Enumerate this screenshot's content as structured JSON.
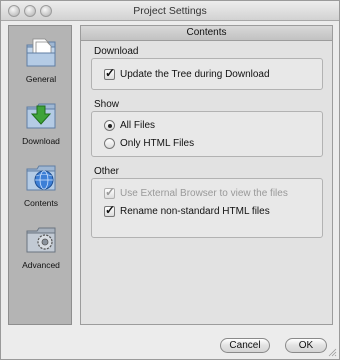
{
  "window": {
    "title": "Project Settings"
  },
  "sidebar": {
    "items": [
      {
        "label": "General",
        "icon": "general-icon"
      },
      {
        "label": "Download",
        "icon": "download-icon"
      },
      {
        "label": "Contents",
        "icon": "contents-icon"
      },
      {
        "label": "Advanced",
        "icon": "advanced-icon"
      }
    ],
    "selected": "Contents"
  },
  "main": {
    "header": "Contents",
    "download_group": {
      "title": "Download",
      "options": [
        {
          "label": "Update the Tree during Download",
          "checked": true,
          "enabled": true
        }
      ]
    },
    "show_group": {
      "title": "Show",
      "options": [
        {
          "label": "All Files",
          "selected": true
        },
        {
          "label": "Only HTML Files",
          "selected": false
        }
      ]
    },
    "other_group": {
      "title": "Other",
      "options": [
        {
          "label": "Use External Browser to view the files",
          "checked": true,
          "enabled": false
        },
        {
          "label": "Rename non-standard HTML files",
          "checked": true,
          "enabled": true
        }
      ]
    }
  },
  "buttons": {
    "cancel": "Cancel",
    "ok": "OK"
  }
}
